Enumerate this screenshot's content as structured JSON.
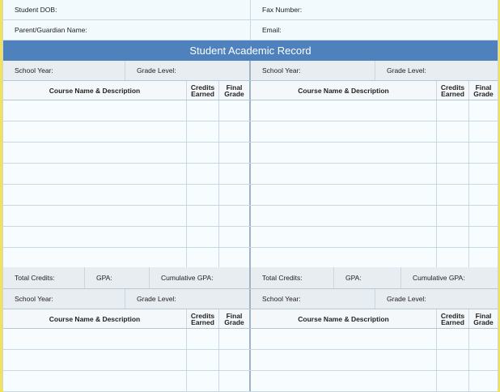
{
  "student_info": {
    "dob_label": "Student DOB:",
    "fax_label": "Fax Number:",
    "guardian_label": "Parent/Guardian Name:",
    "email_label": "Email:"
  },
  "section_title": "Student Academic Record",
  "term_labels": {
    "school_year": "School Year:",
    "grade_level": "Grade Level:"
  },
  "table_headers": {
    "course": "Course Name & Description",
    "credits_line1": "Credits",
    "credits_line2": "Earned",
    "final_line1": "Final",
    "final_line2": "Grade"
  },
  "totals_labels": {
    "total_credits": "Total Credits:",
    "gpa": "GPA:",
    "cumulative_gpa": "Cumulative GPA:"
  },
  "colors": {
    "banner": "#4f81bd",
    "page_border": "#f1e25a"
  }
}
